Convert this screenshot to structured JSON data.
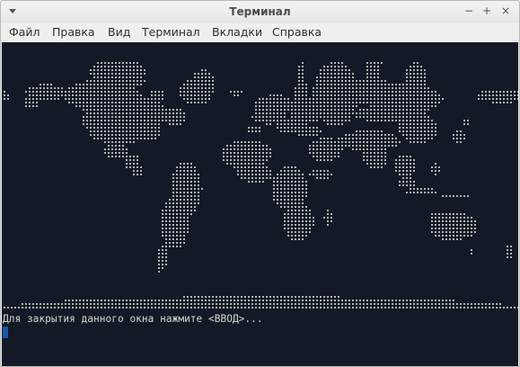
{
  "window": {
    "title": "Терминал",
    "controls": {
      "minimize": "−",
      "maximize": "+",
      "close": "×"
    }
  },
  "menubar": {
    "items": [
      "Файл",
      "Правка",
      "Вид",
      "Терминал",
      "Вкладки",
      "Справка"
    ]
  },
  "terminal": {
    "map_glyph": "·",
    "prompt_text": "Для закрытия данного окна нажмите <ВВОД>...",
    "colors": {
      "background": "#131926",
      "foreground": "#d3d7cf",
      "cursor": "#1d57a6"
    }
  },
  "icons": {
    "window_menu": "chevron-down-icon",
    "minimize": "minimize-icon",
    "maximize": "maximize-icon",
    "close": "close-icon"
  }
}
